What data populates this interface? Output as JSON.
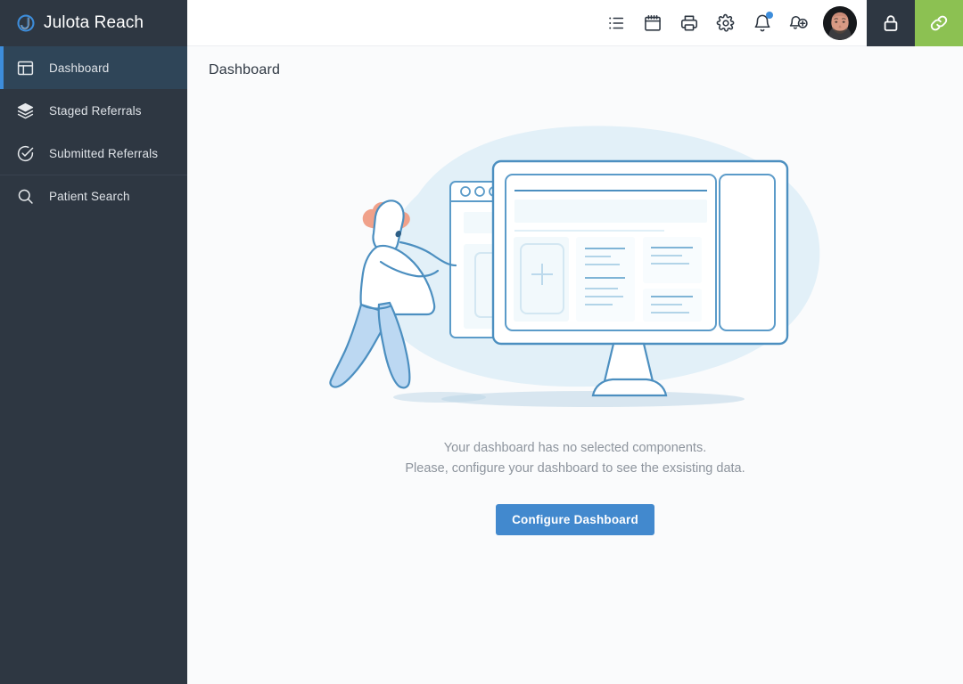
{
  "brand": {
    "name": "Julota Reach",
    "logo_icon": "julota-circle-j-logo",
    "logo_color": "#3d8ddb"
  },
  "sidebar": {
    "background_color": "#2e3742",
    "active_background_color": "#2f4558",
    "active_accent_color": "#3d8ddb",
    "items": [
      {
        "label": "Dashboard",
        "icon": "layout-dashboard-icon",
        "active": true,
        "divider_above": false
      },
      {
        "label": "Staged Referrals",
        "icon": "layers-icon",
        "active": false,
        "divider_above": false
      },
      {
        "label": "Submitted Referrals",
        "icon": "check-circle-icon",
        "active": false,
        "divider_above": false
      },
      {
        "label": "Patient Search",
        "icon": "search-icon",
        "active": false,
        "divider_above": true
      }
    ]
  },
  "topbar": {
    "icons": [
      {
        "name": "list-icon",
        "title": "List"
      },
      {
        "name": "calendar-icon",
        "title": "Calendar"
      },
      {
        "name": "printer-icon",
        "title": "Print"
      },
      {
        "name": "gear-icon",
        "title": "Settings"
      },
      {
        "name": "bell-icon",
        "title": "Notifications",
        "badge": true,
        "badge_color": "#3d8ddb"
      },
      {
        "name": "bell-plus-icon",
        "title": "Add Notification"
      }
    ],
    "avatar": {
      "name": "user-avatar",
      "alt": "User profile photo"
    },
    "lock_button": {
      "icon": "lock-icon",
      "background_color": "#2e3742"
    },
    "link_button": {
      "icon": "link-chain-icon",
      "background_color": "#8cc152"
    }
  },
  "page": {
    "title": "Dashboard",
    "background_color": "#fafbfc"
  },
  "empty_state": {
    "illustration": "person-configuring-dashboard-illustration",
    "line1": "Your dashboard has no selected components.",
    "line2": "Please, configure your dashboard to see the exsisting data.",
    "button_label": "Configure Dashboard",
    "button_color": "#4289ce",
    "text_color": "#8d949d"
  }
}
